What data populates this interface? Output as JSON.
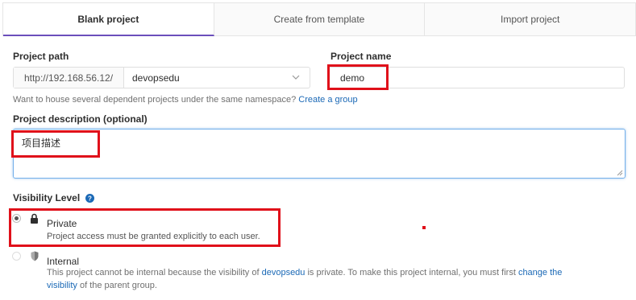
{
  "tabs": [
    {
      "label": "Blank project",
      "active": true
    },
    {
      "label": "Create from template",
      "active": false
    },
    {
      "label": "Import project",
      "active": false
    }
  ],
  "project_path": {
    "label": "Project path",
    "prefix": "http://192.168.56.12/",
    "namespace": "devopsedu"
  },
  "project_name": {
    "label": "Project name",
    "value": "demo"
  },
  "namespace_help": {
    "text": "Want to house several dependent projects under the same namespace? ",
    "link": "Create a group"
  },
  "description": {
    "label": "Project description (optional)",
    "value": "项目描述"
  },
  "visibility": {
    "label": "Visibility Level",
    "help_icon": "question-circle-icon",
    "options": [
      {
        "title": "Private",
        "icon": "lock-icon",
        "selected": true,
        "description": "Project access must be granted explicitly to each user."
      },
      {
        "title": "Internal",
        "icon": "shield-icon",
        "selected": false,
        "disabled": true,
        "description_prefix": "This project cannot be internal because the visibility of ",
        "description_link": "devopsedu",
        "description_middle": " is private. To make this project internal, you must first ",
        "description_link2": "change the",
        "description_link3": "visibility",
        "description_suffix": " of the parent group."
      }
    ]
  },
  "colors": {
    "accent": "#6b4fbb",
    "link": "#1b69b6",
    "highlight_box": "#e0101a",
    "focus_border": "#73afea"
  }
}
